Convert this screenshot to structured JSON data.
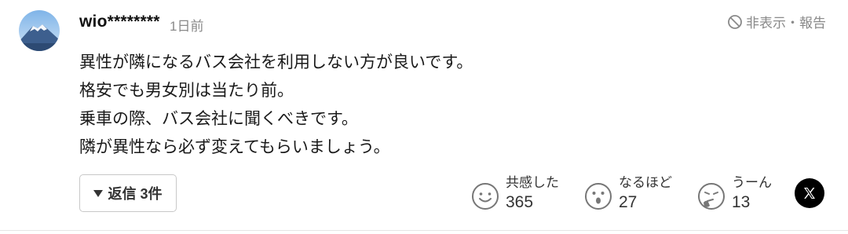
{
  "comment": {
    "username": "wio********",
    "time": "1日前",
    "report_label": "非表示・報告",
    "lines": [
      "異性が隣になるバス会社を利用しない方が良いです。",
      "格安でも男女別は当たり前。",
      "乗車の際、バス会社に聞くべきです。",
      "隣が異性なら必ず変えてもらいましょう。"
    ],
    "reply_label": "返信 3件"
  },
  "reactions": [
    {
      "label": "共感した",
      "count": "365",
      "icon": "smile-face-icon"
    },
    {
      "label": "なるほど",
      "count": "27",
      "icon": "surprised-face-icon"
    },
    {
      "label": "うーん",
      "count": "13",
      "icon": "thinking-face-icon"
    }
  ],
  "share": {
    "icon": "x-logo-icon"
  },
  "colors": {
    "muted_text": "#8a8a8a",
    "icon_gray": "#777777",
    "avatar_sky": "#4a8fd6"
  }
}
